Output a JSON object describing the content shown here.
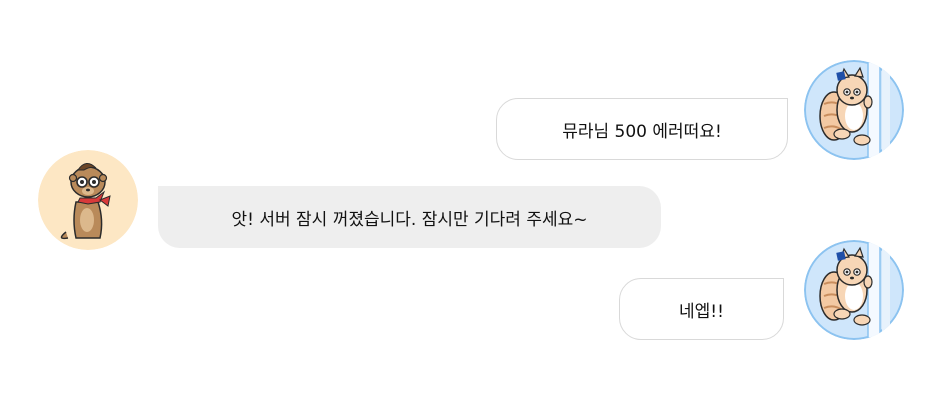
{
  "messages": [
    {
      "sender": "user",
      "avatar": "squirrel-avatar",
      "text": "뮤라님 500 에러떠요!"
    },
    {
      "sender": "bot",
      "avatar": "meerkat-avatar",
      "text": "앗! 서버 잠시 꺼졌습니다. 잠시만 기다려 주세요~"
    },
    {
      "sender": "user",
      "avatar": "squirrel-avatar",
      "text": "네엡!!"
    }
  ],
  "colors": {
    "user_avatar_bg": "#cfe6fb",
    "bot_avatar_bg": "#fde7c4",
    "user_bubble_border": "#d9d9d9",
    "bot_bubble_bg": "#eeeeee"
  }
}
